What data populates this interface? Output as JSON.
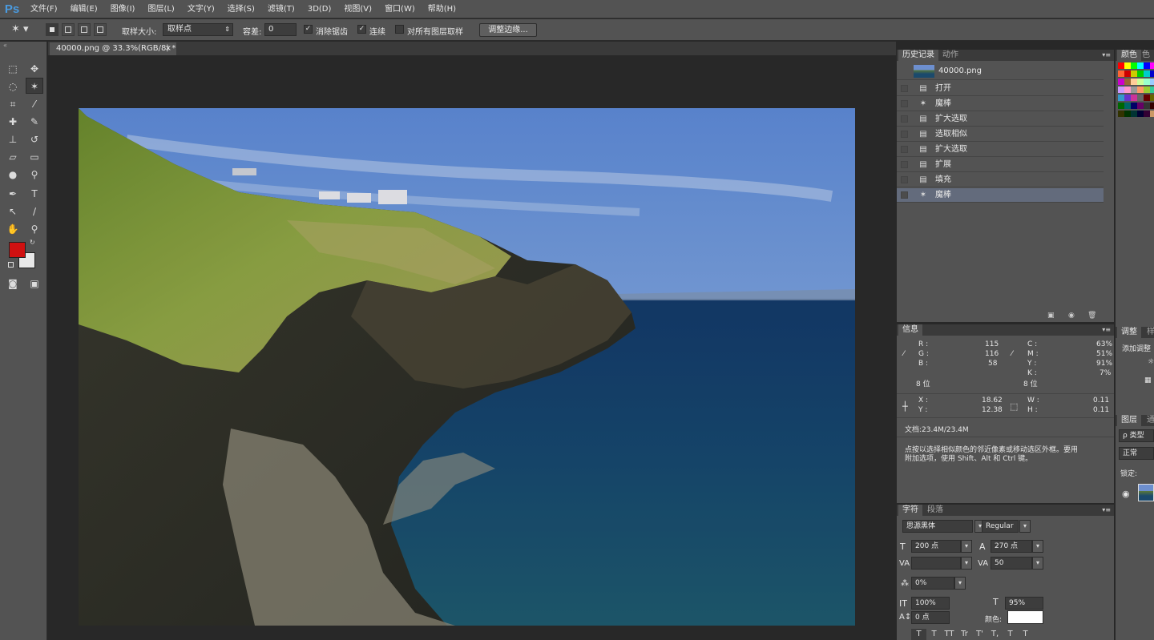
{
  "app": {
    "logo": "Ps"
  },
  "menu": [
    "文件(F)",
    "编辑(E)",
    "图像(I)",
    "图层(L)",
    "文字(Y)",
    "选择(S)",
    "滤镜(T)",
    "3D(D)",
    "视图(V)",
    "窗口(W)",
    "帮助(H)"
  ],
  "options": {
    "sample_size_label": "取样大小:",
    "sample_size_value": "取样点",
    "tolerance_label": "容差:",
    "tolerance_value": "0",
    "antialias_label": "消除锯齿",
    "contiguous_label": "连续",
    "all_layers_label": "对所有图层取样",
    "refine_edge_label": "调整边缘..."
  },
  "document": {
    "tab_title": "40000.png @ 33.3%(RGB/8) *",
    "close_glyph": "×"
  },
  "history_panel": {
    "tabs": [
      "历史记录",
      "动作"
    ],
    "snapshot": "40000.png",
    "steps": [
      "打开",
      "魔棒",
      "扩大选取",
      "选取相似",
      "扩大选取",
      "扩展",
      "填充",
      "魔棒"
    ],
    "selected_index": 7
  },
  "info_panel": {
    "tab": "信息",
    "rgb": {
      "r_label": "R :",
      "g_label": "G :",
      "b_label": "B :",
      "r": "115",
      "g": "116",
      "b": "58",
      "bits": "8 位"
    },
    "cmyk": {
      "c_label": "C :",
      "m_label": "M :",
      "y_label": "Y :",
      "k_label": "K :",
      "c": "63%",
      "m": "51%",
      "y": "91%",
      "k": "7%",
      "bits": "8 位"
    },
    "xy": {
      "x_label": "X :",
      "y_label": "Y :",
      "x": "18.62",
      "y": "12.38"
    },
    "wh": {
      "w_label": "W :",
      "h_label": "H :",
      "w": "0.11",
      "h": "0.11"
    },
    "doc_size": "文档:23.4M/23.4M",
    "hint_line1": "点按以选择相似颜色的邻近像素或移动选区外框。要用",
    "hint_line2": "附加选项，使用 Shift、Alt 和 Ctrl 键。"
  },
  "char_panel": {
    "tabs": [
      "字符",
      "段落"
    ],
    "font_family": "思源黑体",
    "font_style": "Regular",
    "font_size": "200 点",
    "leading": "270 点",
    "tracking": "50",
    "scale_pct": "0%",
    "vscale": "100%",
    "hscale": "95%",
    "baseline": "0 点",
    "color_label": "颜色:",
    "style_buttons": [
      "T",
      "T",
      "TT",
      "Tr",
      "T'",
      "T,",
      "T",
      "T"
    ]
  },
  "right_dock": {
    "color_tabs": [
      "颜色",
      "色"
    ],
    "adj_tabs": [
      "调整",
      "样"
    ],
    "adj_title": "添加调整",
    "layers_tabs": [
      "图层",
      "通"
    ],
    "layer_filter": "ρ 类型",
    "blend_mode": "正常",
    "lock_label": "锁定:"
  },
  "colors": {
    "foreground": "#d01010",
    "background": "#e8e8e8",
    "accent": "#4a9be0"
  }
}
